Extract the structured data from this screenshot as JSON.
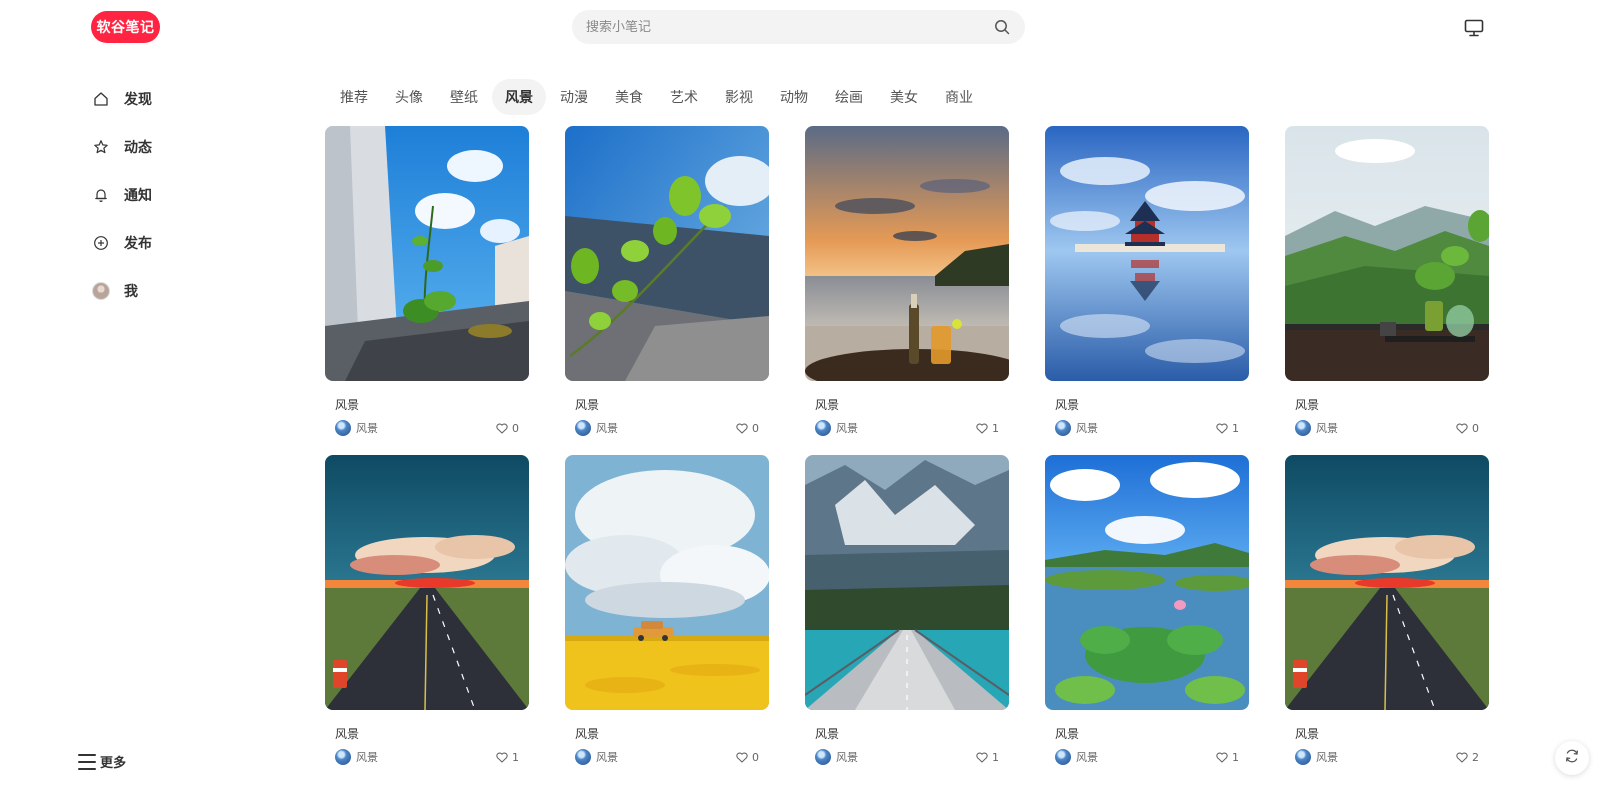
{
  "header": {
    "logo_text": "软谷笔记",
    "search_placeholder": "搜索小笔记",
    "icons": {
      "search": "search-icon",
      "monitor": "monitor-icon"
    },
    "brand_color": "#ff2442"
  },
  "sidebar": {
    "items": [
      {
        "label": "发现",
        "icon": "home-icon",
        "active": true
      },
      {
        "label": "动态",
        "icon": "star-icon",
        "active": false
      },
      {
        "label": "通知",
        "icon": "bell-icon",
        "active": false
      },
      {
        "label": "发布",
        "icon": "plus-circle-icon",
        "active": false
      },
      {
        "label": "我",
        "icon": "avatar",
        "active": false
      }
    ],
    "more_label": "更多"
  },
  "tabs": [
    {
      "label": "推荐",
      "active": false
    },
    {
      "label": "头像",
      "active": false
    },
    {
      "label": "壁纸",
      "active": false
    },
    {
      "label": "风景",
      "active": true
    },
    {
      "label": "动漫",
      "active": false
    },
    {
      "label": "美食",
      "active": false
    },
    {
      "label": "艺术",
      "active": false
    },
    {
      "label": "影视",
      "active": false
    },
    {
      "label": "动物",
      "active": false
    },
    {
      "label": "绘画",
      "active": false
    },
    {
      "label": "美女",
      "active": false
    },
    {
      "label": "商业",
      "active": false
    }
  ],
  "cards": [
    {
      "title": "风景",
      "author": "风景",
      "likes": "0",
      "image": "sprout-wall-sky"
    },
    {
      "title": "风景",
      "author": "风景",
      "likes": "0",
      "image": "leaf-branch-sky"
    },
    {
      "title": "风景",
      "author": "风景",
      "likes": "1",
      "image": "beach-sunset-drinks"
    },
    {
      "title": "风景",
      "author": "风景",
      "likes": "1",
      "image": "temple-reflection"
    },
    {
      "title": "风景",
      "author": "风景",
      "likes": "0",
      "image": "mountain-window-plant"
    },
    {
      "title": "风景",
      "author": "风景",
      "likes": "1",
      "image": "highway-sunset"
    },
    {
      "title": "风景",
      "author": "风景",
      "likes": "0",
      "image": "clouds-flower-field-car"
    },
    {
      "title": "风景",
      "author": "风景",
      "likes": "1",
      "image": "bridge-mountains"
    },
    {
      "title": "风景",
      "author": "风景",
      "likes": "1",
      "image": "lotus-lake"
    },
    {
      "title": "风景",
      "author": "风景",
      "likes": "2",
      "image": "highway-sunset"
    }
  ],
  "footer": {
    "refresh_icon": "refresh-icon"
  }
}
